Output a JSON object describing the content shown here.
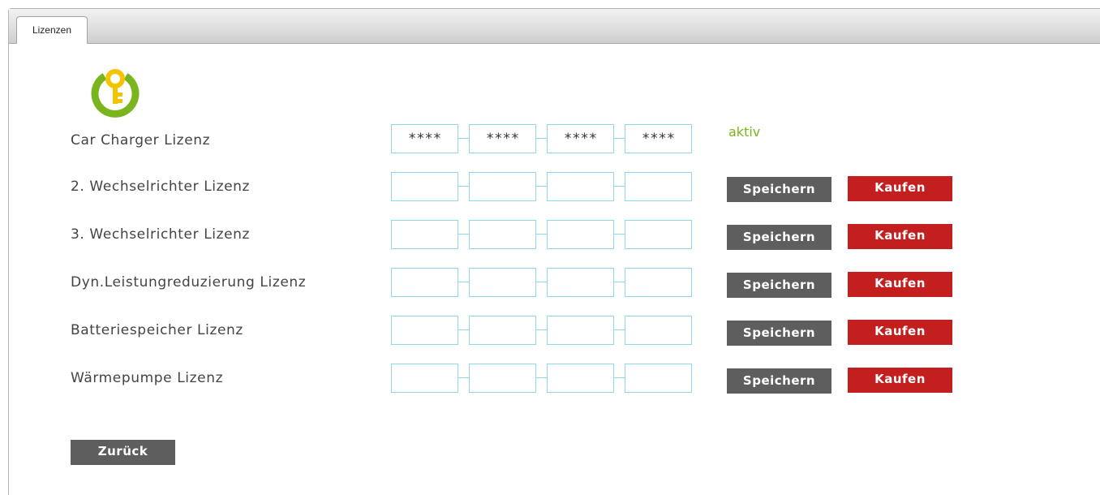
{
  "tab": {
    "label": "Lizenzen"
  },
  "logo": {
    "icon": "key-power-icon",
    "colors": {
      "ring": "#7ab51d",
      "key": "#f4c400"
    }
  },
  "status_color": "#7ab51d",
  "licenses": [
    {
      "label": "Car Charger Lizenz",
      "segments": [
        "****",
        "****",
        "****",
        "****"
      ],
      "status": "aktiv"
    },
    {
      "label": "2. Wechselrichter Lizenz",
      "segments": [
        "",
        "",
        "",
        ""
      ],
      "save": "Speichern",
      "buy": "Kaufen"
    },
    {
      "label": "3. Wechselrichter Lizenz",
      "segments": [
        "",
        "",
        "",
        ""
      ],
      "save": "Speichern",
      "buy": "Kaufen"
    },
    {
      "label": "Dyn.Leistungreduzierung Lizenz",
      "segments": [
        "",
        "",
        "",
        ""
      ],
      "save": "Speichern",
      "buy": "Kaufen"
    },
    {
      "label": "Batteriespeicher Lizenz",
      "segments": [
        "",
        "",
        "",
        ""
      ],
      "save": "Speichern",
      "buy": "Kaufen"
    },
    {
      "label": "Wärmepumpe Lizenz",
      "segments": [
        "",
        "",
        "",
        ""
      ],
      "save": "Speichern",
      "buy": "Kaufen"
    }
  ],
  "back_label": "Zurück"
}
